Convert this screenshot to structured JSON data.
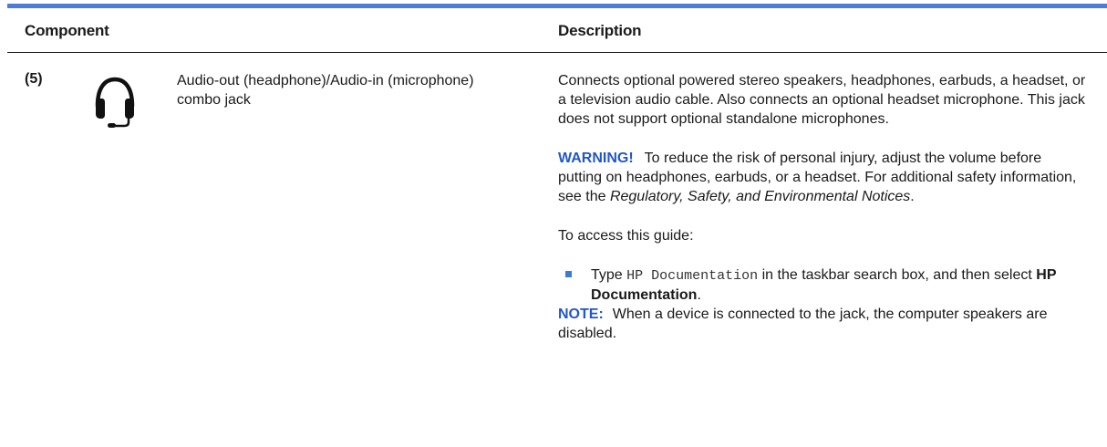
{
  "header": {
    "component": "Component",
    "description": "Description"
  },
  "row": {
    "number": "(5)",
    "icon": "headset-icon",
    "name": "Audio-out (headphone)/Audio-in (microphone) combo jack",
    "desc1": "Connects optional powered stereo speakers, headphones, earbuds, a headset, or a television audio cable. Also connects an optional headset microphone. This jack does not support optional standalone microphones.",
    "warning_label": "WARNING!",
    "warning_text": "To reduce the risk of personal injury, adjust the volume before putting on headphones, earbuds, or a headset. For additional safety information, see the",
    "warning_doc": "Regulatory, Safety, and Environmental Notices",
    "warning_end": ".",
    "access_text": "To access this guide:",
    "bullet_pre": "Type",
    "bullet_code": "HP Documentation",
    "bullet_mid": "in the taskbar search box, and then select",
    "bullet_bold": "HP Documentation",
    "bullet_end": ".",
    "note_label": "NOTE:",
    "note_text": "When a device is connected to the jack, the computer speakers are disabled."
  },
  "colors": {
    "rule": "#4f7bd9",
    "label": "#2257c9",
    "bullet": "#3a7bd5"
  }
}
